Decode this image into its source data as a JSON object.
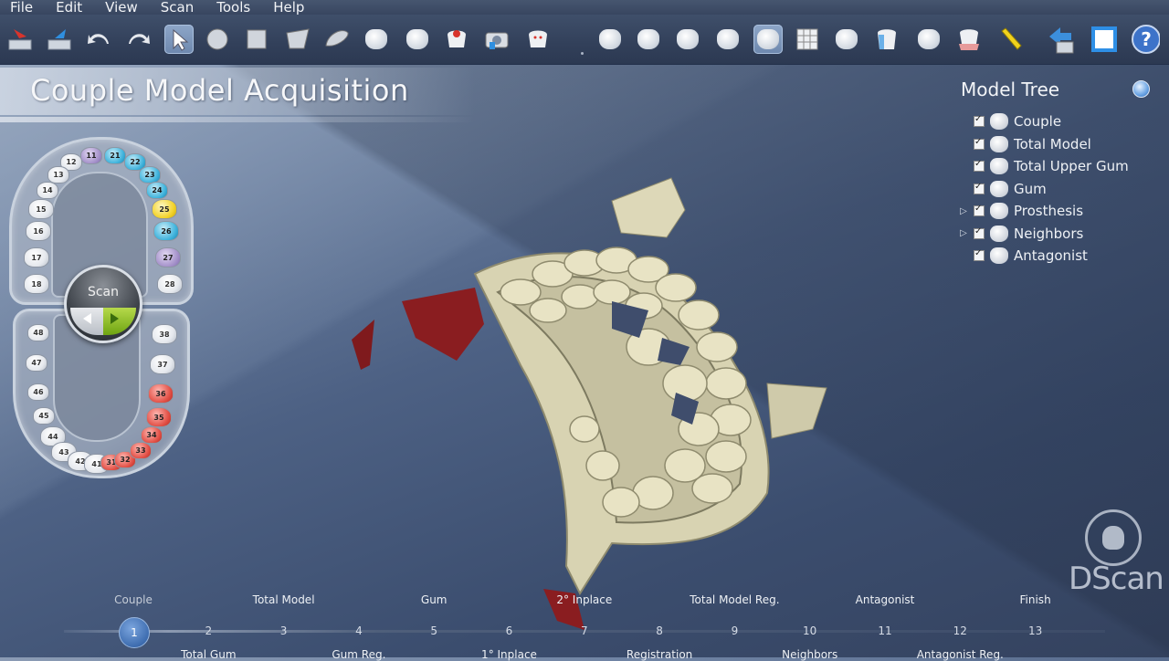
{
  "menu": [
    "File",
    "Edit",
    "View",
    "Scan",
    "Tools",
    "Help"
  ],
  "toolbar": {
    "help_label": "?"
  },
  "page_title": "Couple Model Acquisition",
  "scan_button": {
    "label": "Scan"
  },
  "tooth_chart": {
    "upper": [
      {
        "num": "11",
        "color": "purple"
      },
      {
        "num": "12",
        "color": "white"
      },
      {
        "num": "13",
        "color": "white"
      },
      {
        "num": "14",
        "color": "white"
      },
      {
        "num": "15",
        "color": "white"
      },
      {
        "num": "16",
        "color": "white"
      },
      {
        "num": "17",
        "color": "white"
      },
      {
        "num": "18",
        "color": "white"
      },
      {
        "num": "21",
        "color": "blue"
      },
      {
        "num": "22",
        "color": "blue"
      },
      {
        "num": "23",
        "color": "blue"
      },
      {
        "num": "24",
        "color": "blue"
      },
      {
        "num": "25",
        "color": "yellow"
      },
      {
        "num": "26",
        "color": "blue"
      },
      {
        "num": "27",
        "color": "purple"
      },
      {
        "num": "28",
        "color": "white"
      }
    ],
    "lower": [
      {
        "num": "48",
        "color": "white"
      },
      {
        "num": "47",
        "color": "white"
      },
      {
        "num": "46",
        "color": "white"
      },
      {
        "num": "45",
        "color": "white"
      },
      {
        "num": "44",
        "color": "white"
      },
      {
        "num": "43",
        "color": "white"
      },
      {
        "num": "42",
        "color": "white"
      },
      {
        "num": "41",
        "color": "white"
      },
      {
        "num": "31",
        "color": "red"
      },
      {
        "num": "32",
        "color": "red"
      },
      {
        "num": "33",
        "color": "red"
      },
      {
        "num": "34",
        "color": "red"
      },
      {
        "num": "35",
        "color": "red"
      },
      {
        "num": "36",
        "color": "red"
      },
      {
        "num": "37",
        "color": "white"
      },
      {
        "num": "38",
        "color": "white"
      }
    ],
    "colors": {
      "white": "#e6e9ee",
      "purple": "#a08cc7",
      "blue": "#3fb3dc",
      "yellow": "#f2d227",
      "red": "#e24f45"
    }
  },
  "model_tree": {
    "title": "Model Tree",
    "items": [
      {
        "label": "Couple",
        "expandable": false
      },
      {
        "label": "Total Model",
        "expandable": false
      },
      {
        "label": "Total Upper Gum",
        "expandable": false
      },
      {
        "label": "Gum",
        "expandable": false
      },
      {
        "label": "Prosthesis",
        "expandable": true
      },
      {
        "label": "Neighbors",
        "expandable": true
      },
      {
        "label": "Antagonist",
        "expandable": false
      }
    ]
  },
  "logo": {
    "text": "DScan"
  },
  "timeline": {
    "current_step": 1,
    "steps": [
      {
        "num": "1",
        "top": "Couple",
        "bottom": ""
      },
      {
        "num": "2",
        "top": "",
        "bottom": "Total Gum"
      },
      {
        "num": "3",
        "top": "Total Model",
        "bottom": ""
      },
      {
        "num": "4",
        "top": "",
        "bottom": "Gum Reg."
      },
      {
        "num": "5",
        "top": "Gum",
        "bottom": ""
      },
      {
        "num": "6",
        "top": "",
        "bottom": "1° Inplace"
      },
      {
        "num": "7",
        "top": "2° Inplace",
        "bottom": ""
      },
      {
        "num": "8",
        "top": "",
        "bottom": "Registration"
      },
      {
        "num": "9",
        "top": "Total Model Reg.",
        "bottom": ""
      },
      {
        "num": "10",
        "top": "",
        "bottom": "Neighbors"
      },
      {
        "num": "11",
        "top": "Antagonist",
        "bottom": ""
      },
      {
        "num": "12",
        "top": "",
        "bottom": "Antagonist Reg."
      },
      {
        "num": "13",
        "top": "Finish",
        "bottom": ""
      }
    ]
  }
}
